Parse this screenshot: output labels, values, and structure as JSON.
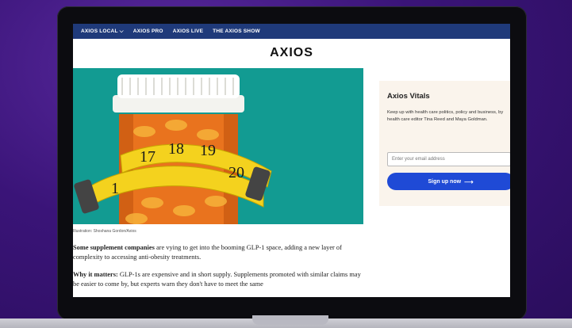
{
  "nav": {
    "items": [
      "AXIOS LOCAL",
      "AXIOS PRO",
      "AXIOS LIVE",
      "THE AXIOS SHOW"
    ]
  },
  "logo": {
    "text": "AXIOS"
  },
  "hero": {
    "caption": "Illustration: Shoshana Gordon/Axios",
    "tape_numbers": [
      "17",
      "18",
      "19",
      "20",
      "1"
    ]
  },
  "article": {
    "p1_lead": "Some supplement companies",
    "p1_rest": " are vying to get into the booming GLP-1 space, adding a new layer of complexity to accessing anti-obesity treatments.",
    "p2_lead": "Why it matters:",
    "p2_rest": " GLP-1s are expensive and in short supply. Supplements promoted with similar claims may be easier to come by, but experts warn they don't have to meet the same"
  },
  "sidebar": {
    "title": "Axios Vitals",
    "description": "Keep up with health care politics, policy and business, by health care editor Tina Reed and Maya Goldman.",
    "email_placeholder": "Enter your email address",
    "signup_label": "Sign up now"
  },
  "colors": {
    "nav_bg": "#1f3a7a",
    "hero_bg": "#129b92",
    "button_bg": "#1f4ad6",
    "sidebar_bg": "#faf4ec"
  }
}
